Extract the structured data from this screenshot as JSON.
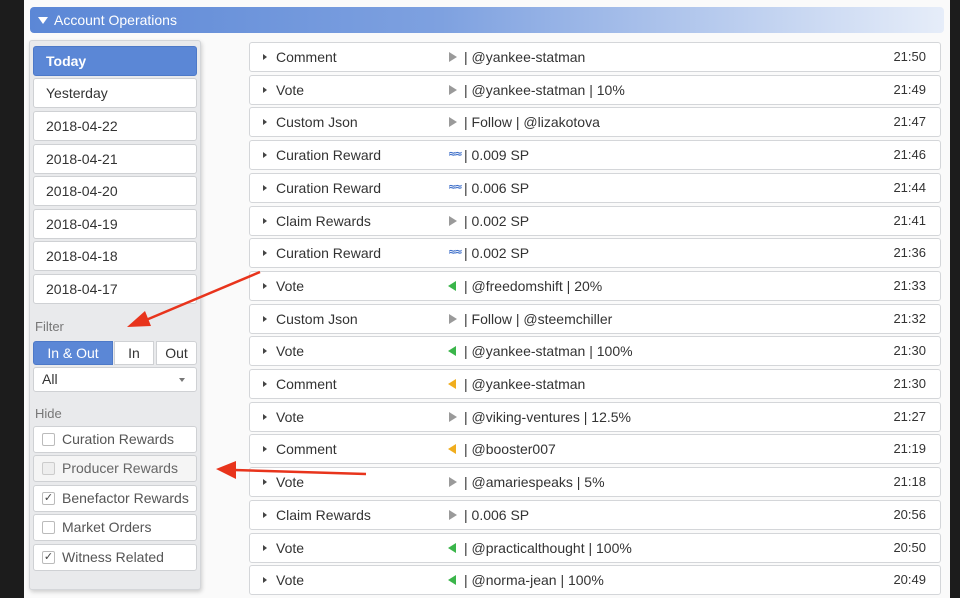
{
  "header": {
    "title": "Account Operations"
  },
  "sidebar": {
    "dates": [
      "Today",
      "Yesterday",
      "2018-04-22",
      "2018-04-21",
      "2018-04-20",
      "2018-04-19",
      "2018-04-18",
      "2018-04-17"
    ],
    "active_date": "Today",
    "filter_label": "Filter",
    "filter_tabs": [
      "In & Out",
      "In",
      "Out"
    ],
    "active_filter": "In & Out",
    "filter_select": "All",
    "hide_label": "Hide",
    "hide_options": [
      {
        "label": "Curation Rewards",
        "checked": false,
        "disabled": false
      },
      {
        "label": "Producer Rewards",
        "checked": false,
        "disabled": true
      },
      {
        "label": "Benefactor Rewards",
        "checked": true,
        "disabled": false
      },
      {
        "label": "Market Orders",
        "checked": false,
        "disabled": false
      },
      {
        "label": "Witness Related",
        "checked": true,
        "disabled": false
      }
    ]
  },
  "operations": [
    {
      "type": "Comment",
      "icon": "outgoing-grey-icon",
      "detail": "| @yankee-statman",
      "time": "21:50"
    },
    {
      "type": "Vote",
      "icon": "outgoing-grey-icon",
      "detail": "| @yankee-statman | 10%",
      "time": "21:49"
    },
    {
      "type": "Custom Json",
      "icon": "outgoing-grey-icon",
      "detail": "| Follow | @lizakotova",
      "time": "21:47"
    },
    {
      "type": "Curation Reward",
      "icon": "steem-icon",
      "detail": "| 0.009 SP",
      "time": "21:46"
    },
    {
      "type": "Curation Reward",
      "icon": "steem-icon",
      "detail": "| 0.006 SP",
      "time": "21:44"
    },
    {
      "type": "Claim Rewards",
      "icon": "outgoing-grey-icon",
      "detail": "| 0.002 SP",
      "time": "21:41"
    },
    {
      "type": "Curation Reward",
      "icon": "steem-icon",
      "detail": "| 0.002 SP",
      "time": "21:36"
    },
    {
      "type": "Vote",
      "icon": "incoming-green-icon",
      "detail": "| @freedomshift | 20%",
      "time": "21:33"
    },
    {
      "type": "Custom Json",
      "icon": "outgoing-grey-icon",
      "detail": "| Follow | @steemchiller",
      "time": "21:32"
    },
    {
      "type": "Vote",
      "icon": "incoming-green-icon",
      "detail": "| @yankee-statman | 100%",
      "time": "21:30"
    },
    {
      "type": "Comment",
      "icon": "incoming-orange-icon",
      "detail": "| @yankee-statman",
      "time": "21:30"
    },
    {
      "type": "Vote",
      "icon": "outgoing-grey-icon",
      "detail": "| @viking-ventures | 12.5%",
      "time": "21:27"
    },
    {
      "type": "Comment",
      "icon": "incoming-orange-icon",
      "detail": "| @booster007",
      "time": "21:19"
    },
    {
      "type": "Vote",
      "icon": "outgoing-grey-icon",
      "detail": "| @amariespeaks | 5%",
      "time": "21:18"
    },
    {
      "type": "Claim Rewards",
      "icon": "outgoing-grey-icon",
      "detail": "| 0.006 SP",
      "time": "20:56"
    },
    {
      "type": "Vote",
      "icon": "incoming-green-icon",
      "detail": "| @practicalthought | 100%",
      "time": "20:50"
    },
    {
      "type": "Vote",
      "icon": "incoming-green-icon",
      "detail": "| @norma-jean | 100%",
      "time": "20:49"
    }
  ],
  "annotation_color": "#e8341c"
}
